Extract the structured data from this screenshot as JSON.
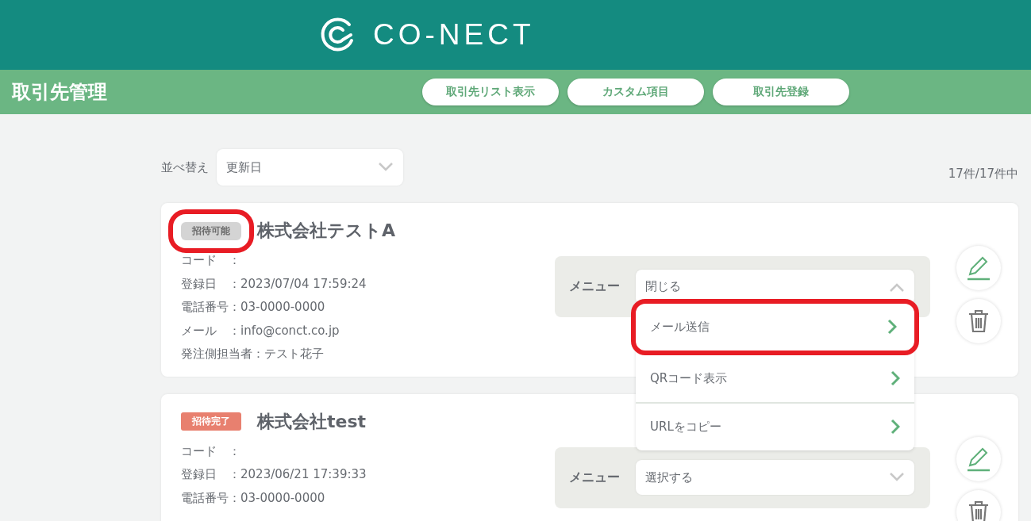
{
  "header": {
    "logo_text": "CO-NECT"
  },
  "subheader": {
    "title": "取引先管理",
    "nav_buttons": [
      "取引先リスト表示",
      "カスタム項目",
      "取引先登録"
    ]
  },
  "sort": {
    "label": "並べ替え",
    "value": "更新日"
  },
  "count": "17件/17件中",
  "partners": [
    {
      "badge": {
        "label": "招待可能",
        "kind": "available",
        "highlighted": true
      },
      "name": "株式会社テストA",
      "lines": [
        "コード　：",
        "登録日　：2023/07/04 17:59:24",
        "電話番号：03-0000-0000",
        "メール　：info@conct.co.jp",
        "発注側担当者：テスト花子"
      ],
      "menu": {
        "label": "メニュー",
        "value": "閉じる",
        "expanded": true,
        "options": [
          {
            "label": "メール送信",
            "highlighted": true
          },
          {
            "label": "QRコード表示",
            "highlighted": false
          },
          {
            "label": "URLをコピー",
            "highlighted": false
          }
        ]
      }
    },
    {
      "badge": {
        "label": "招待完了",
        "kind": "done",
        "highlighted": false
      },
      "name": "株式会社test",
      "lines": [
        "コード　：",
        "登録日　：2023/06/21 17:39:33",
        "電話番号：03-0000-0000"
      ],
      "menu": {
        "label": "メニュー",
        "value": "選択する",
        "expanded": false
      }
    }
  ]
}
